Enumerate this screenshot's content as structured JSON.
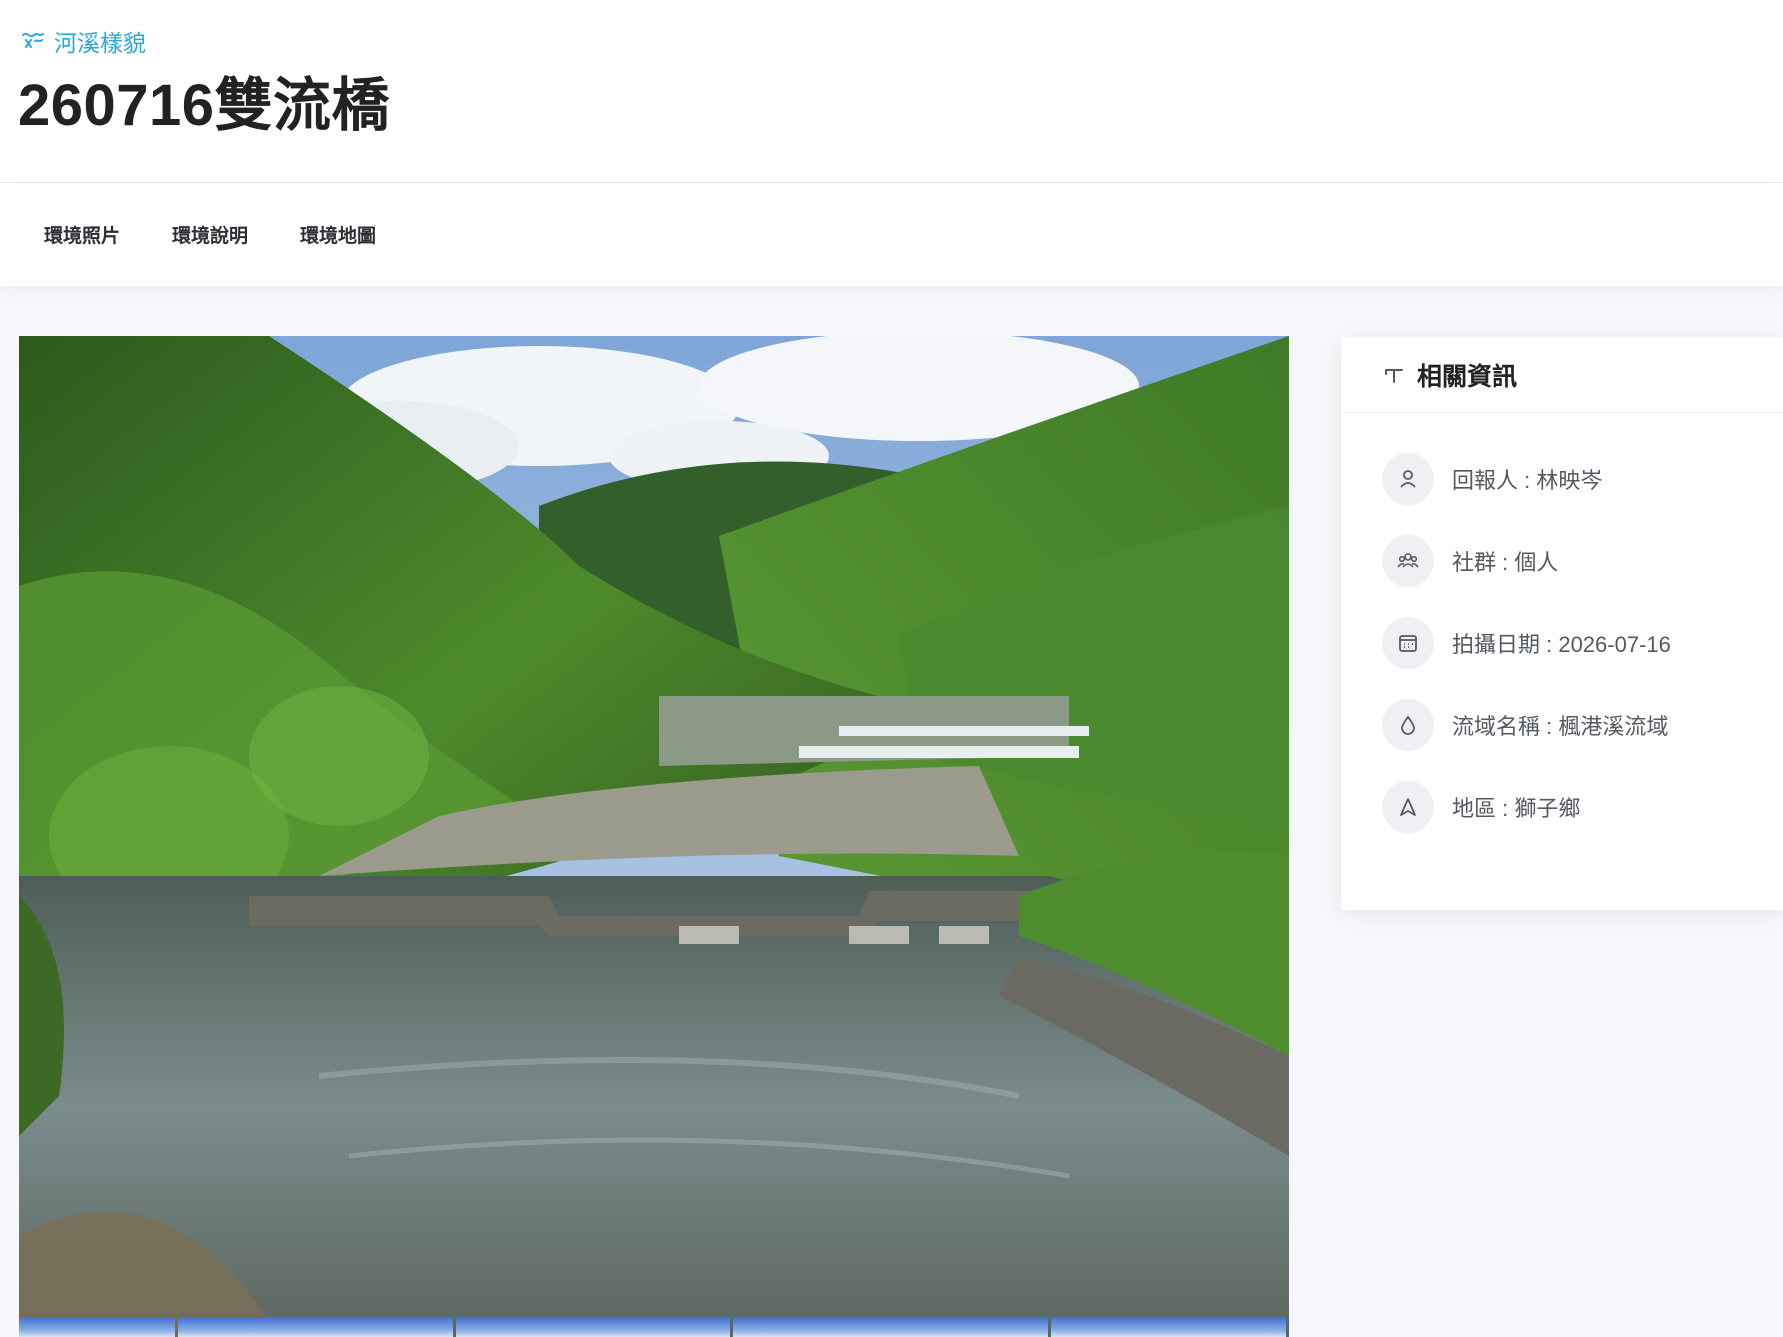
{
  "breadcrumb": {
    "label": "河溪樣貌",
    "icon": "river-icon",
    "color": "#2aa7de"
  },
  "page_title": "260716雙流橋",
  "tabs": [
    {
      "label": "環境照片"
    },
    {
      "label": "環境說明"
    },
    {
      "label": "環境地圖"
    }
  ],
  "photo": {
    "description_icon": "river-landscape-photo",
    "thumbnail_count": 5
  },
  "info_panel": {
    "title": "相關資訊",
    "title_icon": "pin-icon",
    "items": [
      {
        "icon": "user-icon",
        "text": "回報人 : 林映岑"
      },
      {
        "icon": "group-icon",
        "text": "社群 : 個人"
      },
      {
        "icon": "calendar-icon",
        "text": "拍攝日期 : 2026-07-16"
      },
      {
        "icon": "water-drop-icon",
        "text": "流域名稱 : 楓港溪流域"
      },
      {
        "icon": "location-icon",
        "text": "地區 : 獅子鄉"
      }
    ]
  },
  "colors": {
    "accent": "#2aa7de",
    "background": "#f6f7fa",
    "card": "#ffffff",
    "icon_circle": "#eef0f3"
  }
}
